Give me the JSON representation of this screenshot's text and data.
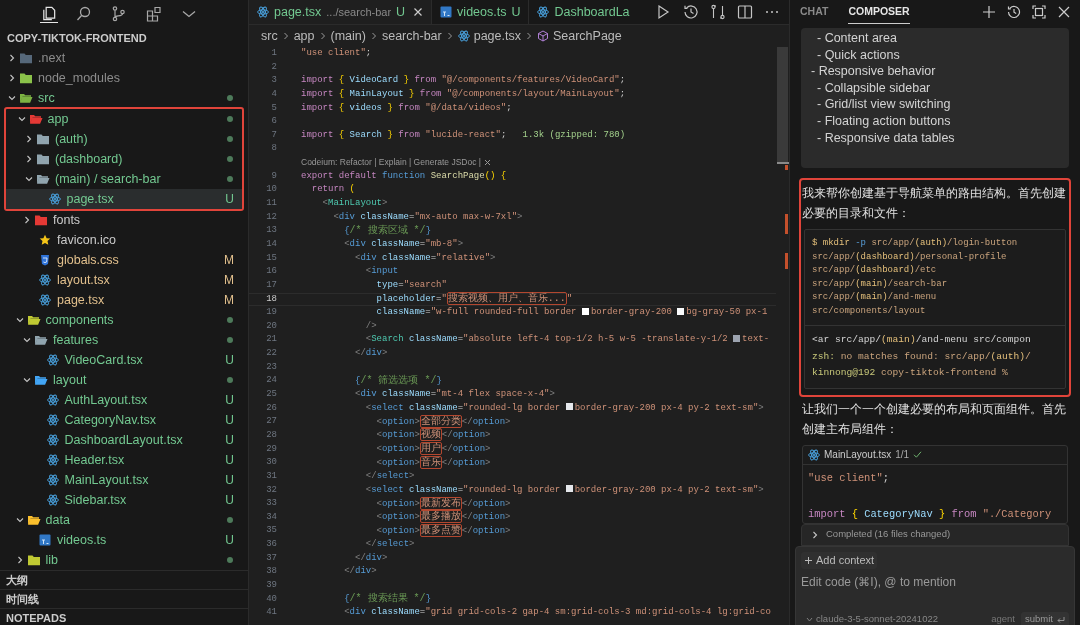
{
  "explorer": {
    "title": "COPY-TIKTOK-FRONTEND",
    "tree": [
      {
        "name": ".next",
        "kind": "folder",
        "color": "#56687a",
        "expanded": false,
        "ignored": true,
        "selected": false
      },
      {
        "name": "node_modules",
        "kind": "folder",
        "color": "#8bc34a",
        "expanded": false,
        "ignored": true,
        "selected": false
      },
      {
        "name": "src",
        "kind": "folder",
        "color": "#7cb342",
        "expanded": true,
        "dot": true,
        "selected": false,
        "children": [
          {
            "name": "app",
            "kind": "folder",
            "color": "#e53935",
            "expanded": true,
            "dot": true,
            "selected": false,
            "outlined": true,
            "children": [
              {
                "name": "(auth)",
                "kind": "folder",
                "color": "#90a4ae",
                "expanded": false,
                "dot": true,
                "selected": false,
                "outlined": true
              },
              {
                "name": "(dashboard)",
                "kind": "folder",
                "color": "#90a4ae",
                "expanded": false,
                "dot": true,
                "selected": false,
                "outlined": true
              },
              {
                "name": "(main) / search-bar",
                "kind": "folder",
                "color": "#90a4ae",
                "expanded": true,
                "dot": true,
                "selected": false,
                "outlined": true,
                "children": [
                  {
                    "name": "page.tsx",
                    "kind": "react",
                    "badge": "U",
                    "selected": true,
                    "outlined": true
                  }
                ]
              },
              {
                "name": "fonts",
                "kind": "folder",
                "color": "#e53935",
                "expanded": false,
                "selected": false
              },
              {
                "name": "favicon.ico",
                "kind": "star",
                "selected": false
              },
              {
                "name": "globals.css",
                "kind": "css",
                "badge": "M",
                "modified": true,
                "selected": false
              },
              {
                "name": "layout.tsx",
                "kind": "react",
                "badge": "M",
                "modified": true,
                "selected": false
              },
              {
                "name": "page.tsx",
                "kind": "react",
                "badge": "M",
                "modified": true,
                "selected": false
              }
            ]
          },
          {
            "name": "components",
            "kind": "folder",
            "color": "#c0ca33",
            "expanded": true,
            "dot": true,
            "selected": false,
            "children": [
              {
                "name": "features",
                "kind": "folder",
                "color": "#90a4ae",
                "expanded": true,
                "dot": true,
                "selected": false,
                "children": [
                  {
                    "name": "VideoCard.tsx",
                    "kind": "react",
                    "badge": "U",
                    "selected": false
                  }
                ]
              },
              {
                "name": "layout",
                "kind": "folder",
                "color": "#42a5f5",
                "expanded": true,
                "dot": true,
                "selected": false,
                "children": [
                  {
                    "name": "AuthLayout.tsx",
                    "kind": "react",
                    "badge": "U",
                    "selected": false
                  },
                  {
                    "name": "CategoryNav.tsx",
                    "kind": "react",
                    "badge": "U",
                    "selected": false
                  },
                  {
                    "name": "DashboardLayout.tsx",
                    "kind": "react",
                    "badge": "U",
                    "selected": false
                  },
                  {
                    "name": "Header.tsx",
                    "kind": "react",
                    "badge": "U",
                    "selected": false
                  },
                  {
                    "name": "MainLayout.tsx",
                    "kind": "react",
                    "badge": "U",
                    "selected": false
                  },
                  {
                    "name": "Sidebar.tsx",
                    "kind": "react",
                    "badge": "U",
                    "selected": false
                  }
                ]
              }
            ]
          },
          {
            "name": "data",
            "kind": "folder",
            "color": "#fbc02d",
            "expanded": true,
            "dot": true,
            "selected": false,
            "children": [
              {
                "name": "videos.ts",
                "kind": "ts",
                "badge": "U",
                "selected": false
              }
            ]
          },
          {
            "name": "lib",
            "kind": "folder",
            "color": "#c0ca33",
            "expanded": false,
            "dot": true,
            "selected": false
          }
        ]
      }
    ],
    "sections": [
      "大纲",
      "时间线",
      "NOTEPADS"
    ]
  },
  "editor": {
    "tabs": [
      {
        "label": "page.tsx",
        "detail": ".../search-bar",
        "badge": "U",
        "kind": "react",
        "selected": true
      },
      {
        "label": "videos.ts",
        "badge": "U",
        "kind": "ts",
        "selected": false
      },
      {
        "label": "DashboardLa",
        "kind": "react",
        "selected": false
      }
    ],
    "breadcrumb": [
      {
        "text": "src",
        "kind": "folder"
      },
      {
        "text": "app",
        "kind": "folder"
      },
      {
        "text": "(main)",
        "kind": "folder"
      },
      {
        "text": "search-bar",
        "kind": "folder"
      },
      {
        "text": "page.tsx",
        "kind": "react"
      },
      {
        "text": "SearchPage",
        "kind": "symbol"
      }
    ],
    "lines": [
      {
        "kind": "code",
        "n": "1",
        "current": false,
        "tokens": [
          {
            "kind": "str",
            "text": "\"use client\""
          },
          {
            "kind": "p",
            "text": ";"
          }
        ]
      },
      {
        "kind": "code",
        "n": "2",
        "current": false
      },
      {
        "kind": "code",
        "n": "3",
        "current": false,
        "tokens": [
          {
            "kind": "kw",
            "text": "import "
          },
          {
            "kind": "br",
            "text": "{"
          },
          {
            "kind": "id",
            "text": " VideoCard "
          },
          {
            "kind": "br",
            "text": "}"
          },
          {
            "kind": "kw",
            "text": " from "
          },
          {
            "kind": "str",
            "text": "\"@/components/features/VideoCard\""
          },
          {
            "kind": "p",
            "text": ";"
          }
        ]
      },
      {
        "kind": "code",
        "n": "4",
        "current": false,
        "tokens": [
          {
            "kind": "kw",
            "text": "import "
          },
          {
            "kind": "br",
            "text": "{"
          },
          {
            "kind": "id",
            "text": " MainLayout "
          },
          {
            "kind": "br",
            "text": "}"
          },
          {
            "kind": "kw",
            "text": " from "
          },
          {
            "kind": "str",
            "text": "\"@/components/layout/MainLayout\""
          },
          {
            "kind": "p",
            "text": ";"
          }
        ]
      },
      {
        "kind": "code",
        "n": "5",
        "current": false,
        "tokens": [
          {
            "kind": "kw",
            "text": "import "
          },
          {
            "kind": "br",
            "text": "{"
          },
          {
            "kind": "id",
            "text": " videos "
          },
          {
            "kind": "br",
            "text": "}"
          },
          {
            "kind": "kw",
            "text": " from "
          },
          {
            "kind": "str",
            "text": "\"@/data/videos\""
          },
          {
            "kind": "p",
            "text": ";"
          }
        ]
      },
      {
        "kind": "code",
        "n": "6",
        "current": false
      },
      {
        "kind": "code",
        "n": "7",
        "current": false,
        "tokens": [
          {
            "kind": "kw",
            "text": "import "
          },
          {
            "kind": "br",
            "text": "{"
          },
          {
            "kind": "id",
            "text": " Search "
          },
          {
            "kind": "br",
            "text": "}"
          },
          {
            "kind": "kw",
            "text": " from "
          },
          {
            "kind": "str",
            "text": "\"lucide-react\""
          },
          {
            "kind": "p",
            "text": ";"
          },
          {
            "kind": "hint",
            "text": "   1.3k (gzipped: 780)"
          }
        ]
      },
      {
        "kind": "code",
        "n": "8",
        "current": false
      },
      {
        "kind": "lens",
        "text": "Codeium: Refactor | Explain | Generate JSDoc |"
      },
      {
        "kind": "code",
        "n": "9",
        "current": false,
        "tokens": [
          {
            "kind": "kw",
            "text": "export default "
          },
          {
            "kind": "decl",
            "text": "function "
          },
          {
            "kind": "fn",
            "text": "SearchPage"
          },
          {
            "kind": "br",
            "text": "() {"
          }
        ]
      },
      {
        "kind": "code",
        "n": "10",
        "current": false,
        "tokens": [
          {
            "kind": "kw",
            "text": "  return "
          },
          {
            "kind": "br",
            "text": "("
          }
        ]
      },
      {
        "kind": "code",
        "n": "11",
        "current": false,
        "tokens": [
          {
            "kind": "pu",
            "text": "    <"
          },
          {
            "kind": "comp",
            "text": "MainLayout"
          },
          {
            "kind": "pu",
            "text": ">"
          }
        ]
      },
      {
        "kind": "code",
        "n": "12",
        "current": false,
        "tokens": [
          {
            "kind": "pu",
            "text": "      <"
          },
          {
            "kind": "tag",
            "text": "div"
          },
          {
            "kind": "attr",
            "text": " className"
          },
          {
            "kind": "p",
            "text": "="
          },
          {
            "kind": "str",
            "text": "\"mx-auto max-w-7xl\""
          },
          {
            "kind": "pu",
            "text": ">"
          }
        ]
      },
      {
        "kind": "code",
        "n": "13",
        "current": false,
        "tokens": [
          {
            "kind": "cmb",
            "text": "        {"
          },
          {
            "kind": "cm",
            "text": "/* 搜索区域 */"
          },
          {
            "kind": "cmb",
            "text": "}"
          }
        ]
      },
      {
        "kind": "code",
        "n": "14",
        "current": false,
        "tokens": [
          {
            "kind": "pu",
            "text": "        <"
          },
          {
            "kind": "tag",
            "text": "div"
          },
          {
            "kind": "attr",
            "text": " className"
          },
          {
            "kind": "p",
            "text": "="
          },
          {
            "kind": "str",
            "text": "\"mb-8\""
          },
          {
            "kind": "pu",
            "text": ">"
          }
        ]
      },
      {
        "kind": "code",
        "n": "15",
        "current": false,
        "tokens": [
          {
            "kind": "pu",
            "text": "          <"
          },
          {
            "kind": "tag",
            "text": "div"
          },
          {
            "kind": "attr",
            "text": " className"
          },
          {
            "kind": "p",
            "text": "="
          },
          {
            "kind": "str",
            "text": "\"relative\""
          },
          {
            "kind": "pu",
            "text": ">"
          }
        ]
      },
      {
        "kind": "code",
        "n": "16",
        "current": false,
        "tokens": [
          {
            "kind": "pu",
            "text": "            <"
          },
          {
            "kind": "tag",
            "text": "input"
          }
        ]
      },
      {
        "kind": "code",
        "n": "17",
        "current": false,
        "tokens": [
          {
            "kind": "attr",
            "text": "              type"
          },
          {
            "kind": "p",
            "text": "="
          },
          {
            "kind": "str",
            "text": "\"search\""
          }
        ]
      },
      {
        "kind": "code",
        "n": "18",
        "current": true,
        "tokens": [
          {
            "kind": "attr",
            "text": "              placeholder"
          },
          {
            "kind": "p",
            "text": "="
          },
          {
            "kind": "str",
            "text": "\""
          },
          {
            "kind": "cjk",
            "text": "搜索视频、用户、音乐..."
          },
          {
            "kind": "str",
            "text": "\""
          }
        ]
      },
      {
        "kind": "code",
        "n": "19",
        "current": false,
        "tokens": [
          {
            "kind": "attr",
            "text": "              className"
          },
          {
            "kind": "p",
            "text": "="
          },
          {
            "kind": "str",
            "text": "\"w-full rounded-full border "
          },
          {
            "kind": "swatch",
            "color": "#ffffff"
          },
          {
            "kind": "str",
            "text": "border-gray-200 "
          },
          {
            "kind": "swatch",
            "color": "#f9fafb"
          },
          {
            "kind": "str",
            "text": "bg-gray-50 px-1"
          }
        ]
      },
      {
        "kind": "code",
        "n": "20",
        "current": false,
        "tokens": [
          {
            "kind": "pu",
            "text": "            />"
          }
        ]
      },
      {
        "kind": "code",
        "n": "21",
        "current": false,
        "tokens": [
          {
            "kind": "pu",
            "text": "            <"
          },
          {
            "kind": "comp",
            "text": "Search"
          },
          {
            "kind": "attr",
            "text": " className"
          },
          {
            "kind": "p",
            "text": "="
          },
          {
            "kind": "str",
            "text": "\"absolute left-4 top-1/2 h-5 w-5 -translate-y-1/2 "
          },
          {
            "kind": "swatch",
            "color": "#9ca3af"
          },
          {
            "kind": "str",
            "text": "text-"
          }
        ]
      },
      {
        "kind": "code",
        "n": "22",
        "current": false,
        "tokens": [
          {
            "kind": "pu",
            "text": "          </"
          },
          {
            "kind": "tag",
            "text": "div"
          },
          {
            "kind": "pu",
            "text": ">"
          }
        ]
      },
      {
        "kind": "code",
        "n": "23",
        "current": false
      },
      {
        "kind": "code",
        "n": "24",
        "current": false,
        "tokens": [
          {
            "kind": "cmb",
            "text": "          {"
          },
          {
            "kind": "cm",
            "text": "/* 筛选选项 */"
          },
          {
            "kind": "cmb",
            "text": "}"
          }
        ]
      },
      {
        "kind": "code",
        "n": "25",
        "current": false,
        "tokens": [
          {
            "kind": "pu",
            "text": "          <"
          },
          {
            "kind": "tag",
            "text": "div"
          },
          {
            "kind": "attr",
            "text": " className"
          },
          {
            "kind": "p",
            "text": "="
          },
          {
            "kind": "str",
            "text": "\"mt-4 flex space-x-4\""
          },
          {
            "kind": "pu",
            "text": ">"
          }
        ]
      },
      {
        "kind": "code",
        "n": "26",
        "current": false,
        "tokens": [
          {
            "kind": "pu",
            "text": "            <"
          },
          {
            "kind": "tag",
            "text": "select"
          },
          {
            "kind": "attr",
            "text": " className"
          },
          {
            "kind": "p",
            "text": "="
          },
          {
            "kind": "str",
            "text": "\"rounded-lg border "
          },
          {
            "kind": "swatch",
            "color": "#e5e7eb"
          },
          {
            "kind": "str",
            "text": "border-gray-200 px-4 py-2 text-sm\""
          },
          {
            "kind": "pu",
            "text": ">"
          }
        ]
      },
      {
        "kind": "code",
        "n": "27",
        "current": false,
        "tokens": [
          {
            "kind": "pu",
            "text": "              <"
          },
          {
            "kind": "tag",
            "text": "option"
          },
          {
            "kind": "pu",
            "text": ">"
          },
          {
            "kind": "cjk",
            "text": "全部分类"
          },
          {
            "kind": "pu",
            "text": "</"
          },
          {
            "kind": "tag",
            "text": "option"
          },
          {
            "kind": "pu",
            "text": ">"
          }
        ]
      },
      {
        "kind": "code",
        "n": "28",
        "current": false,
        "tokens": [
          {
            "kind": "pu",
            "text": "              <"
          },
          {
            "kind": "tag",
            "text": "option"
          },
          {
            "kind": "pu",
            "text": ">"
          },
          {
            "kind": "cjk",
            "text": "视频"
          },
          {
            "kind": "pu",
            "text": "</"
          },
          {
            "kind": "tag",
            "text": "option"
          },
          {
            "kind": "pu",
            "text": ">"
          }
        ]
      },
      {
        "kind": "code",
        "n": "29",
        "current": false,
        "tokens": [
          {
            "kind": "pu",
            "text": "              <"
          },
          {
            "kind": "tag",
            "text": "option"
          },
          {
            "kind": "pu",
            "text": ">"
          },
          {
            "kind": "cjk",
            "text": "用户"
          },
          {
            "kind": "pu",
            "text": "</"
          },
          {
            "kind": "tag",
            "text": "option"
          },
          {
            "kind": "pu",
            "text": ">"
          }
        ]
      },
      {
        "kind": "code",
        "n": "30",
        "current": false,
        "tokens": [
          {
            "kind": "pu",
            "text": "              <"
          },
          {
            "kind": "tag",
            "text": "option"
          },
          {
            "kind": "pu",
            "text": ">"
          },
          {
            "kind": "cjk",
            "text": "音乐"
          },
          {
            "kind": "pu",
            "text": "</"
          },
          {
            "kind": "tag",
            "text": "option"
          },
          {
            "kind": "pu",
            "text": ">"
          }
        ]
      },
      {
        "kind": "code",
        "n": "31",
        "current": false,
        "tokens": [
          {
            "kind": "pu",
            "text": "            </"
          },
          {
            "kind": "tag",
            "text": "select"
          },
          {
            "kind": "pu",
            "text": ">"
          }
        ]
      },
      {
        "kind": "code",
        "n": "32",
        "current": false,
        "tokens": [
          {
            "kind": "pu",
            "text": "            <"
          },
          {
            "kind": "tag",
            "text": "select"
          },
          {
            "kind": "attr",
            "text": " className"
          },
          {
            "kind": "p",
            "text": "="
          },
          {
            "kind": "str",
            "text": "\"rounded-lg border "
          },
          {
            "kind": "swatch",
            "color": "#e5e7eb"
          },
          {
            "kind": "str",
            "text": "border-gray-200 px-4 py-2 text-sm\""
          },
          {
            "kind": "pu",
            "text": ">"
          }
        ]
      },
      {
        "kind": "code",
        "n": "33",
        "current": false,
        "tokens": [
          {
            "kind": "pu",
            "text": "              <"
          },
          {
            "kind": "tag",
            "text": "option"
          },
          {
            "kind": "pu",
            "text": ">"
          },
          {
            "kind": "cjk",
            "text": "最新发布"
          },
          {
            "kind": "pu",
            "text": "</"
          },
          {
            "kind": "tag",
            "text": "option"
          },
          {
            "kind": "pu",
            "text": ">"
          }
        ]
      },
      {
        "kind": "code",
        "n": "34",
        "current": false,
        "tokens": [
          {
            "kind": "pu",
            "text": "              <"
          },
          {
            "kind": "tag",
            "text": "option"
          },
          {
            "kind": "pu",
            "text": ">"
          },
          {
            "kind": "cjk",
            "text": "最多播放"
          },
          {
            "kind": "pu",
            "text": "</"
          },
          {
            "kind": "tag",
            "text": "option"
          },
          {
            "kind": "pu",
            "text": ">"
          }
        ]
      },
      {
        "kind": "code",
        "n": "35",
        "current": false,
        "tokens": [
          {
            "kind": "pu",
            "text": "              <"
          },
          {
            "kind": "tag",
            "text": "option"
          },
          {
            "kind": "pu",
            "text": ">"
          },
          {
            "kind": "cjk",
            "text": "最多点赞"
          },
          {
            "kind": "pu",
            "text": "</"
          },
          {
            "kind": "tag",
            "text": "option"
          },
          {
            "kind": "pu",
            "text": ">"
          }
        ]
      },
      {
        "kind": "code",
        "n": "36",
        "current": false,
        "tokens": [
          {
            "kind": "pu",
            "text": "            </"
          },
          {
            "kind": "tag",
            "text": "select"
          },
          {
            "kind": "pu",
            "text": ">"
          }
        ]
      },
      {
        "kind": "code",
        "n": "37",
        "current": false,
        "tokens": [
          {
            "kind": "pu",
            "text": "          </"
          },
          {
            "kind": "tag",
            "text": "div"
          },
          {
            "kind": "pu",
            "text": ">"
          }
        ]
      },
      {
        "kind": "code",
        "n": "38",
        "current": false,
        "tokens": [
          {
            "kind": "pu",
            "text": "        </"
          },
          {
            "kind": "tag",
            "text": "div"
          },
          {
            "kind": "pu",
            "text": ">"
          }
        ]
      },
      {
        "kind": "code",
        "n": "39",
        "current": false
      },
      {
        "kind": "code",
        "n": "40",
        "current": false,
        "tokens": [
          {
            "kind": "cmb",
            "text": "        {"
          },
          {
            "kind": "cm",
            "text": "/* 搜索结果 */"
          },
          {
            "kind": "cmb",
            "text": "}"
          }
        ]
      },
      {
        "kind": "code",
        "n": "41",
        "current": false,
        "tokens": [
          {
            "kind": "pu",
            "text": "        <"
          },
          {
            "kind": "tag",
            "text": "div"
          },
          {
            "kind": "attr",
            "text": " className"
          },
          {
            "kind": "p",
            "text": "="
          },
          {
            "kind": "str",
            "text": "\"grid grid-cols-2 gap-4 sm:grid-cols-3 md:grid-cols-4 lg:grid-co"
          }
        ]
      }
    ]
  },
  "composer": {
    "tabs": [
      {
        "label": "CHAT",
        "selected": false
      },
      {
        "label": "COMPOSER",
        "selected": true
      }
    ],
    "outline": [
      {
        "children": [
          {
            "text": "- Content area"
          },
          {
            "text": "- Quick actions"
          }
        ]
      },
      {
        "text": "- Responsive behavior",
        "children": [
          {
            "text": "- Collapsible sidebar"
          },
          {
            "text": "- Grid/list view switching"
          },
          {
            "text": "- Floating action buttons"
          },
          {
            "text": "- Responsive data tables"
          }
        ]
      }
    ],
    "highlighted_block": {
      "outlined": true,
      "text": "我来帮你创建基于导航菜单的路由结构。首先创建必要的目录和文件：",
      "command": [
        {
          "kind": "y",
          "text": "$ mkdir "
        },
        {
          "kind": "b",
          "text": "-p "
        },
        {
          "kind": "o",
          "text": "src/app/"
        },
        {
          "kind": "y",
          "text": "(auth)"
        },
        {
          "kind": "o",
          "text": "/login-button src/app/"
        },
        {
          "kind": "y",
          "text": "(dashboard)"
        },
        {
          "kind": "o",
          "text": "/personal-profile src/app/"
        },
        {
          "kind": "y",
          "text": "(dashboard)"
        },
        {
          "kind": "o",
          "text": "/etc src/app/"
        },
        {
          "kind": "y",
          "text": "(main)"
        },
        {
          "kind": "o",
          "text": "/search-bar src/app/"
        },
        {
          "kind": "y",
          "text": "(main)"
        },
        {
          "kind": "o",
          "text": "/and-menu src/components/layout"
        }
      ],
      "output": [
        {
          "tokens": [
            {
              "kind": "w",
              "text": "<ar src/app/"
            },
            {
              "kind": "y",
              "text": "(main)"
            },
            {
              "kind": "w",
              "text": "/and-menu src/compon"
            }
          ]
        },
        {
          "tokens": [
            {
              "kind": "g",
              "text": "zsh: "
            },
            {
              "kind": "o",
              "text": "no matches found: src/app/"
            },
            {
              "kind": "y",
              "text": "(auth)"
            },
            {
              "kind": "o",
              "text": "/"
            }
          ]
        },
        {
          "tokens": [
            {
              "kind": "g",
              "text": "kinnong@192 "
            },
            {
              "kind": "o",
              "text": "copy-tiktok-frontend %"
            }
          ]
        }
      ]
    },
    "message": "让我们一个一个创建必要的布局和页面组件。首先创建主布局组件：",
    "file_card": {
      "filename": "MainLayout.tsx",
      "progress": "1/1",
      "done": true,
      "code": [
        {
          "kind": "code",
          "tokens": [
            {
              "kind": "str",
              "text": "\"use client\""
            },
            {
              "kind": "p",
              "text": ";"
            }
          ]
        },
        {
          "kind": "blank"
        },
        {
          "kind": "code",
          "tokens": [
            {
              "kind": "kw",
              "text": "import "
            },
            {
              "kind": "br",
              "text": "{"
            },
            {
              "kind": "id",
              "text": " CategoryNav "
            },
            {
              "kind": "br",
              "text": "}"
            },
            {
              "kind": "kw",
              "text": " from "
            },
            {
              "kind": "str",
              "text": "\"./Category"
            }
          ]
        }
      ]
    },
    "completed": {
      "text": "Completed (16 files changed)",
      "expanded": false
    },
    "input": {
      "add_context": "Add context",
      "placeholder": "Edit code (⌘I), @ to mention",
      "model": "claude-3-5-sonnet-20241022",
      "mode": "agent",
      "submit": "submit"
    }
  }
}
